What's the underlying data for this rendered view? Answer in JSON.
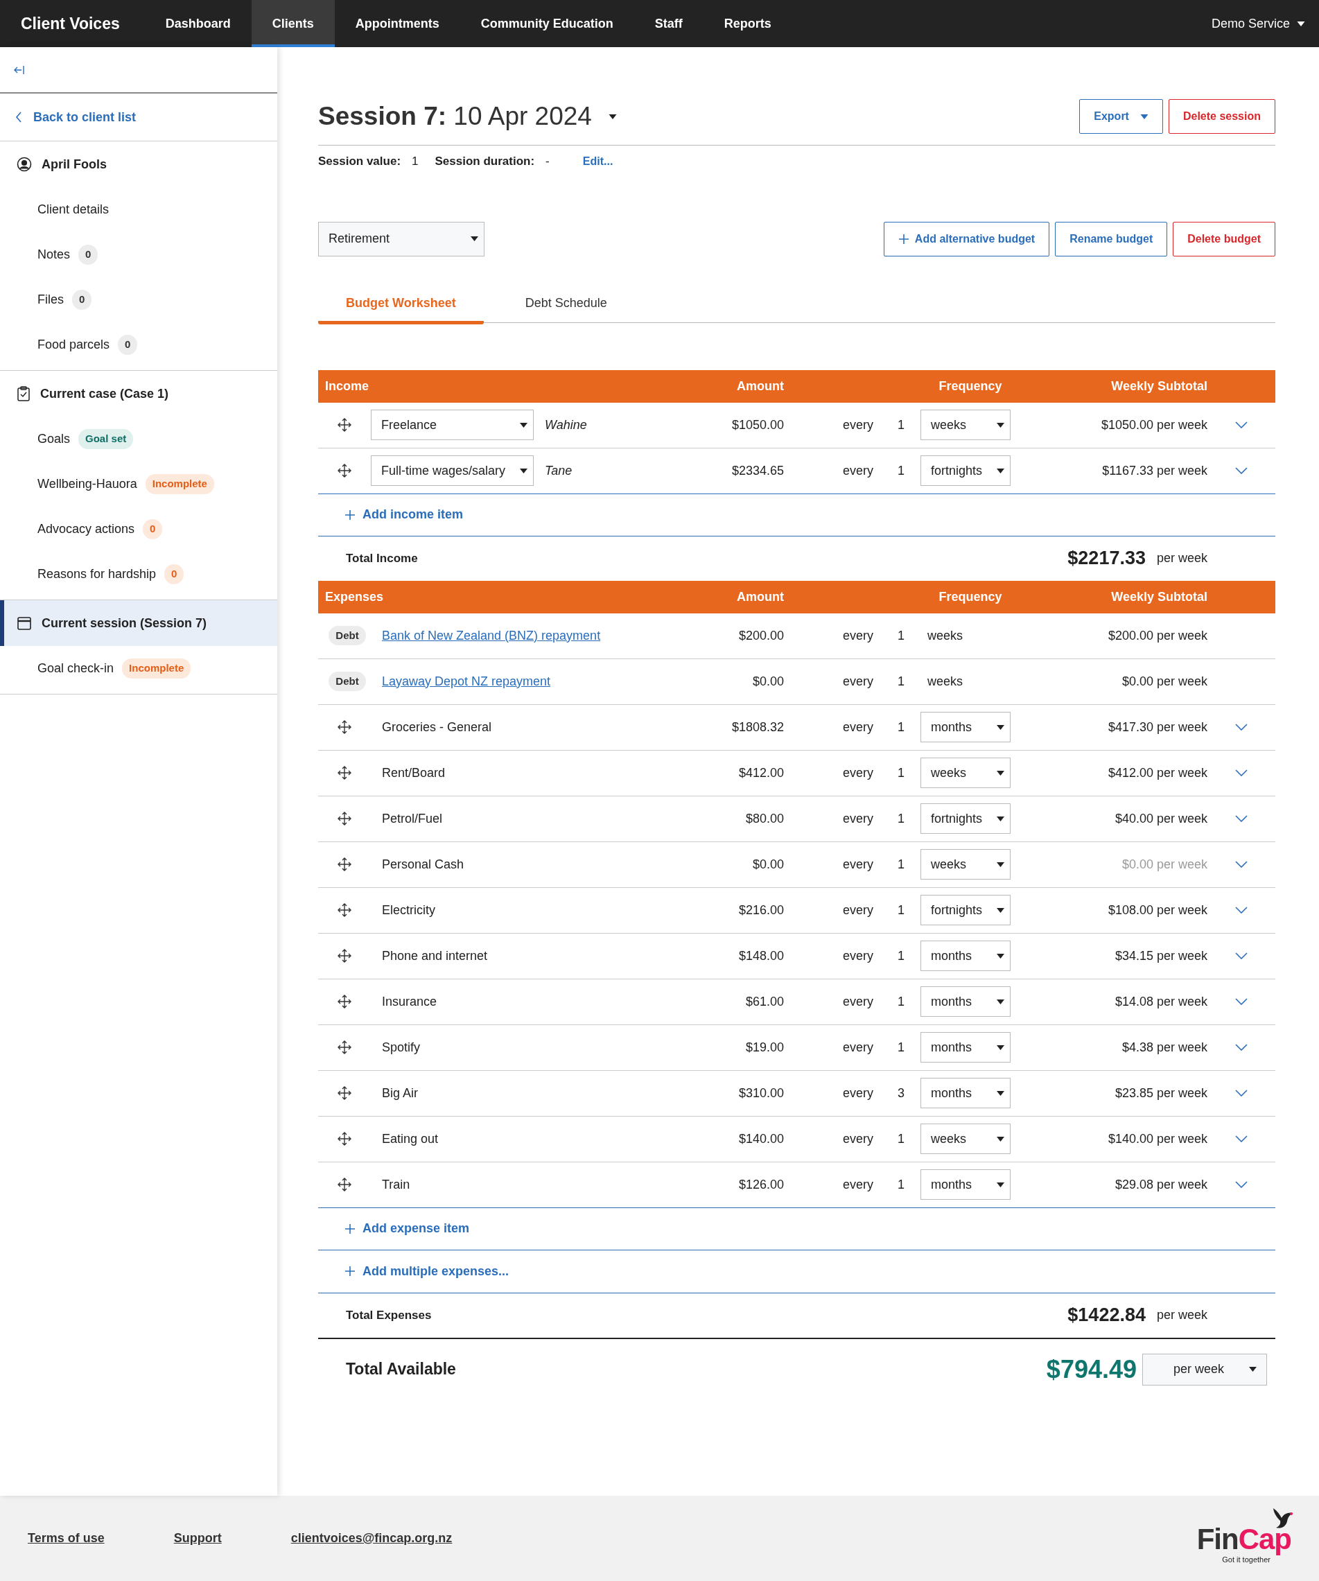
{
  "navbar": {
    "brand": "Client Voices",
    "items": [
      {
        "label": "Dashboard",
        "selected": false
      },
      {
        "label": "Clients",
        "selected": true
      },
      {
        "label": "Appointments",
        "selected": false
      },
      {
        "label": "Community Education",
        "selected": false
      },
      {
        "label": "Staff",
        "selected": false
      },
      {
        "label": "Reports",
        "selected": false
      }
    ],
    "user": "Demo Service"
  },
  "sidebar": {
    "back": "Back to client list",
    "sections": [
      {
        "kind": "client",
        "title": "April Fools",
        "selected": false,
        "items": [
          {
            "kind": "plain",
            "label": "Client details"
          },
          {
            "kind": "count",
            "label": "Notes",
            "badge": "0"
          },
          {
            "kind": "count",
            "label": "Files",
            "badge": "0"
          },
          {
            "kind": "count",
            "label": "Food parcels",
            "badge": "0"
          }
        ]
      },
      {
        "kind": "case",
        "title": "Current case (Case 1)",
        "selected": false,
        "items": [
          {
            "kind": "success",
            "label": "Goals",
            "badge": "Goal set"
          },
          {
            "kind": "warning",
            "label": "Wellbeing-Hauora",
            "badge": "Incomplete"
          },
          {
            "kind": "warning",
            "label": "Advocacy actions",
            "badge": "0"
          },
          {
            "kind": "warning",
            "label": "Reasons for hardship",
            "badge": "0"
          }
        ]
      },
      {
        "kind": "session",
        "title": "Current session (Session 7)",
        "selected": true,
        "items": [
          {
            "kind": "warning",
            "label": "Goal check-in",
            "badge": "Incomplete"
          }
        ]
      }
    ]
  },
  "session": {
    "title": "**Session 7:** 10 Apr 2024",
    "export": "Export",
    "delete": "Delete session",
    "value_label": "Session value:",
    "value": "1",
    "duration_label": "Session duration:",
    "duration": "-",
    "edit": "Edit..."
  },
  "budget": {
    "select": "Retirement",
    "add": "Add alternative budget",
    "rename": "Rename budget",
    "delete": "Delete budget"
  },
  "tabs": [
    {
      "label": "Budget Worksheet",
      "selected": true
    },
    {
      "label": "Debt Schedule",
      "selected": false
    }
  ],
  "income": {
    "columns": [
      "Income",
      "Amount",
      "Frequency",
      "Weekly Subtotal"
    ],
    "rows": [
      {
        "category": "Freelance",
        "person": "Wahine",
        "amount": "$1050.00",
        "every": "every",
        "count": "1",
        "unit": "weeks",
        "subtotal": "$1050.00 per week"
      },
      {
        "category": "Full-time wages/salary",
        "person": "Tane",
        "amount": "$2334.65",
        "every": "every",
        "count": "1",
        "unit": "fortnights",
        "subtotal": "$1167.33 per week"
      }
    ],
    "add": "Add income item",
    "total_label": "Total Income",
    "total": "$2217.33",
    "total_unit": "per week"
  },
  "expenses": {
    "columns": [
      "Expenses",
      "Amount",
      "Frequency",
      "Weekly Subtotal"
    ],
    "rows": [
      {
        "kind": "debt",
        "tag": "Debt",
        "name": "Bank of New Zealand (BNZ) repayment",
        "amount": "$200.00",
        "every": "every",
        "count": "1",
        "unit": "weeks",
        "subtotal": "$200.00 per week",
        "muted": false
      },
      {
        "kind": "debt",
        "tag": "Debt",
        "name": "Layaway Depot NZ repayment",
        "amount": "$0.00",
        "every": "every",
        "count": "1",
        "unit": "weeks",
        "subtotal": "$0.00 per week",
        "muted": false
      },
      {
        "kind": "item",
        "name": "Groceries - General",
        "amount": "$1808.32",
        "every": "every",
        "count": "1",
        "unit": "months",
        "subtotal": "$417.30 per week",
        "muted": false
      },
      {
        "kind": "item",
        "name": "Rent/Board",
        "amount": "$412.00",
        "every": "every",
        "count": "1",
        "unit": "weeks",
        "subtotal": "$412.00 per week",
        "muted": false
      },
      {
        "kind": "item",
        "name": "Petrol/Fuel",
        "amount": "$80.00",
        "every": "every",
        "count": "1",
        "unit": "fortnights",
        "subtotal": "$40.00 per week",
        "muted": false
      },
      {
        "kind": "item",
        "name": "Personal Cash",
        "amount": "$0.00",
        "every": "every",
        "count": "1",
        "unit": "weeks",
        "subtotal": "$0.00 per week",
        "muted": true
      },
      {
        "kind": "item",
        "name": "Electricity",
        "amount": "$216.00",
        "every": "every",
        "count": "1",
        "unit": "fortnights",
        "subtotal": "$108.00 per week",
        "muted": false
      },
      {
        "kind": "item",
        "name": "Phone and internet",
        "amount": "$148.00",
        "every": "every",
        "count": "1",
        "unit": "months",
        "subtotal": "$34.15 per week",
        "muted": false
      },
      {
        "kind": "item",
        "name": "Insurance",
        "amount": "$61.00",
        "every": "every",
        "count": "1",
        "unit": "months",
        "subtotal": "$14.08 per week",
        "muted": false
      },
      {
        "kind": "item",
        "name": "Spotify",
        "amount": "$19.00",
        "every": "every",
        "count": "1",
        "unit": "months",
        "subtotal": "$4.38 per week",
        "muted": false
      },
      {
        "kind": "item",
        "name": "Big Air",
        "amount": "$310.00",
        "every": "every",
        "count": "3",
        "unit": "months",
        "subtotal": "$23.85 per week",
        "muted": false
      },
      {
        "kind": "item",
        "name": "Eating out",
        "amount": "$140.00",
        "every": "every",
        "count": "1",
        "unit": "weeks",
        "subtotal": "$140.00 per week",
        "muted": false
      },
      {
        "kind": "item",
        "name": "Train",
        "amount": "$126.00",
        "every": "every",
        "count": "1",
        "unit": "months",
        "subtotal": "$29.08 per week",
        "muted": false
      }
    ],
    "add": "Add expense item",
    "add_multiple": "Add multiple expenses...",
    "total_label": "Total Expenses",
    "total": "$1422.84",
    "total_unit": "per week"
  },
  "total_available": {
    "label": "Total Available",
    "amount": "$794.49",
    "period": "per week"
  },
  "footer": {
    "links": [
      "Terms of use",
      "Support",
      "clientvoices@fincap.org.nz"
    ],
    "logo": [
      "Fin",
      "Cap"
    ],
    "tagline": "Got it together"
  }
}
